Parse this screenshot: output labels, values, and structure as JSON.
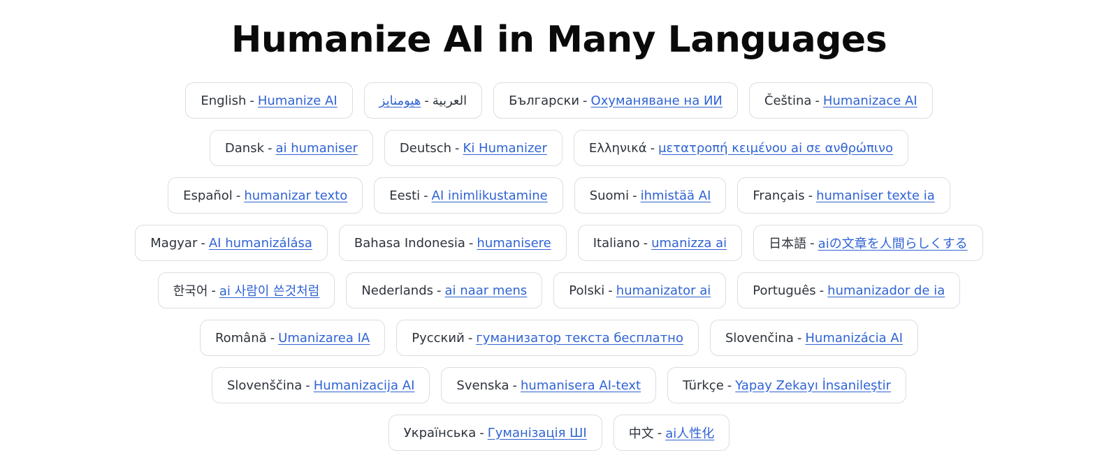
{
  "title": "Humanize AI in Many Languages",
  "separator": "-",
  "link_color": "#2f63d4",
  "rows": [
    [
      {
        "id": "en",
        "lang": "English",
        "link": "Humanize AI"
      },
      {
        "id": "ar",
        "lang": "العربية",
        "link": "هيومنايز",
        "rtl": true
      },
      {
        "id": "bg",
        "lang": "Български",
        "link": "Охуманяване на ИИ"
      },
      {
        "id": "cs",
        "lang": "Čeština",
        "link": "Humanizace AI"
      }
    ],
    [
      {
        "id": "da",
        "lang": "Dansk",
        "link": "ai humaniser"
      },
      {
        "id": "de",
        "lang": "Deutsch",
        "link": "Ki Humanizer"
      },
      {
        "id": "el",
        "lang": "Ελληνικά",
        "link": "μετατροπή κειμένου ai σε ανθρώπινο"
      }
    ],
    [
      {
        "id": "es",
        "lang": "Español",
        "link": "humanizar texto"
      },
      {
        "id": "et",
        "lang": "Eesti",
        "link": "AI inimlikustamine"
      },
      {
        "id": "fi",
        "lang": "Suomi",
        "link": "ihmistää AI"
      },
      {
        "id": "fr",
        "lang": "Français",
        "link": "humaniser texte ia"
      }
    ],
    [
      {
        "id": "hu",
        "lang": "Magyar",
        "link": "AI humanizálása"
      },
      {
        "id": "id",
        "lang": "Bahasa Indonesia",
        "link": "humanisere"
      },
      {
        "id": "it",
        "lang": "Italiano",
        "link": "umanizza ai"
      },
      {
        "id": "ja",
        "lang": "日本語",
        "link": "aiの文章を人間らしくする"
      }
    ],
    [
      {
        "id": "ko",
        "lang": "한국어",
        "link": "ai 사람이 쓴것처럼"
      },
      {
        "id": "nl",
        "lang": "Nederlands",
        "link": "ai naar mens"
      },
      {
        "id": "pl",
        "lang": "Polski",
        "link": "humanizator ai"
      },
      {
        "id": "pt",
        "lang": "Português",
        "link": "humanizador de ia"
      }
    ],
    [
      {
        "id": "ro",
        "lang": "Română",
        "link": "Umanizarea IA"
      },
      {
        "id": "ru",
        "lang": "Русский",
        "link": "гуманизатор текста бесплатно"
      },
      {
        "id": "sk",
        "lang": "Slovenčina",
        "link": "Humanizácia AI"
      }
    ],
    [
      {
        "id": "sl",
        "lang": "Slovenščina",
        "link": "Humanizacija AI"
      },
      {
        "id": "sv",
        "lang": "Svenska",
        "link": "humanisera AI-text"
      },
      {
        "id": "tr",
        "lang": "Türkçe",
        "link": "Yapay Zekayı İnsanileştir"
      }
    ],
    [
      {
        "id": "uk",
        "lang": "Українська",
        "link": "Гуманізація ШІ"
      },
      {
        "id": "zh",
        "lang": "中文",
        "link": "ai人性化"
      }
    ]
  ]
}
